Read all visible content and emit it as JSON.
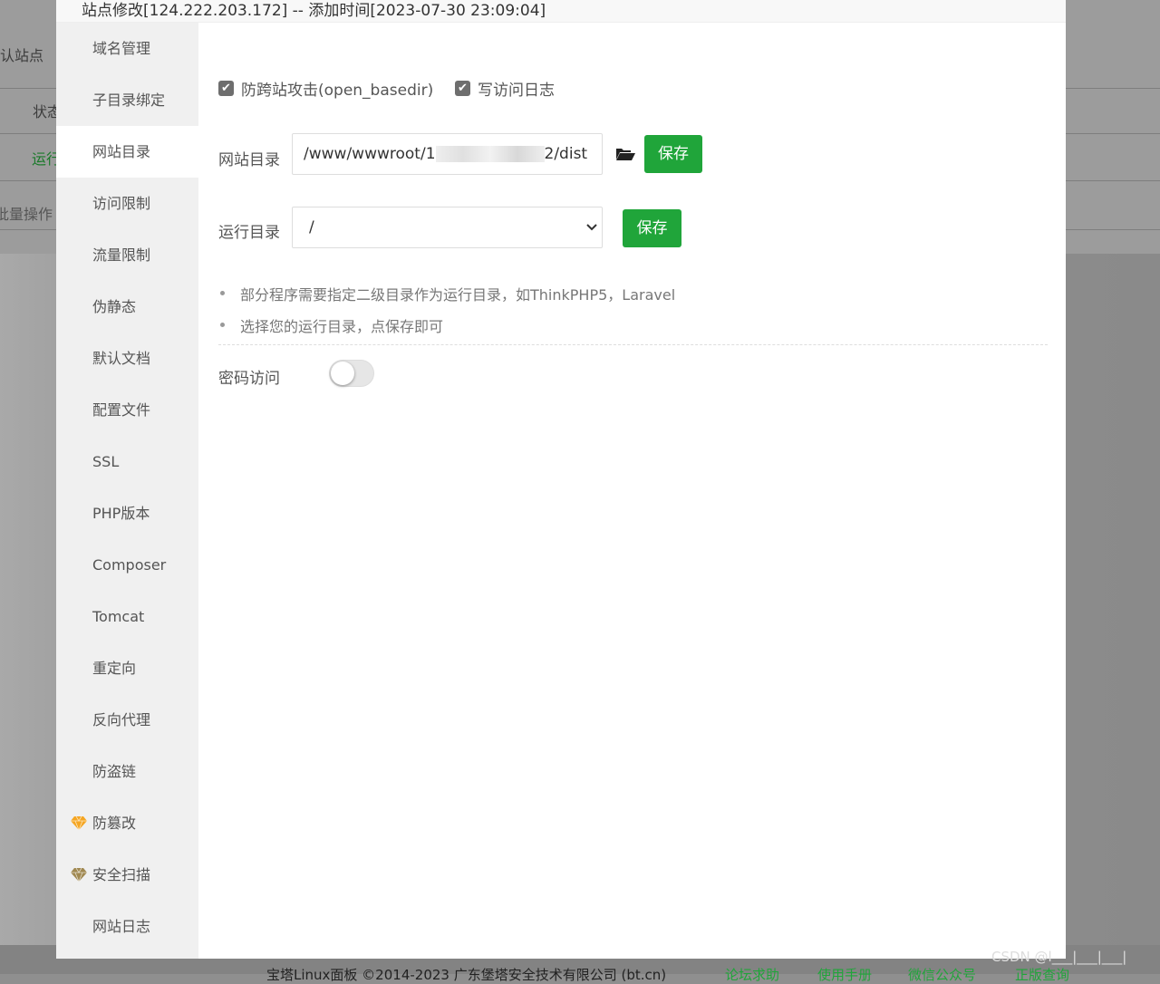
{
  "background": {
    "rows": [
      "认站点",
      "状态",
      "运行",
      "批量操作"
    ],
    "running_color": "#1a7a2a"
  },
  "footer": {
    "copyright": "宝塔Linux面板 ©2014-2023 广东堡塔安全技术有限公司 (bt.cn)",
    "links": [
      "论坛求助",
      "使用手册",
      "微信公众号",
      "正版查询"
    ],
    "link_color": "#20a53a"
  },
  "watermark": "CSDN @l___|___|___|",
  "modal": {
    "title": "站点修改[124.222.203.172] -- 添加时间[2023-07-30 23:09:04]",
    "sidebar": [
      {
        "label": "域名管理"
      },
      {
        "label": "子目录绑定"
      },
      {
        "label": "网站目录",
        "active": true
      },
      {
        "label": "访问限制"
      },
      {
        "label": "流量限制"
      },
      {
        "label": "伪静态"
      },
      {
        "label": "默认文档"
      },
      {
        "label": "配置文件"
      },
      {
        "label": "SSL"
      },
      {
        "label": "PHP版本"
      },
      {
        "label": "Composer"
      },
      {
        "label": "Tomcat"
      },
      {
        "label": "重定向"
      },
      {
        "label": "反向代理"
      },
      {
        "label": "防盗链"
      },
      {
        "label": "防篡改",
        "icon": "gem-icon",
        "icon_color": "#f5a623"
      },
      {
        "label": "安全扫描",
        "icon": "gem-icon",
        "icon_color": "#a08850"
      },
      {
        "label": "网站日志"
      }
    ],
    "options": {
      "open_basedir": {
        "label": "防跨站攻击(open_basedir)",
        "checked": true
      },
      "access_log": {
        "label": "写访问日志",
        "checked": true
      }
    },
    "site_dir": {
      "label": "网站目录",
      "value_start": "/www/wwwroot/1",
      "value_end": "2/dist",
      "save": "保存"
    },
    "run_dir": {
      "label": "运行目录",
      "value": "/",
      "save": "保存"
    },
    "tips": [
      "部分程序需要指定二级目录作为运行目录，如ThinkPHP5，Laravel",
      "选择您的运行目录，点保存即可"
    ],
    "password_access": {
      "label": "密码访问",
      "enabled": false
    },
    "accent": "#20a53a"
  }
}
